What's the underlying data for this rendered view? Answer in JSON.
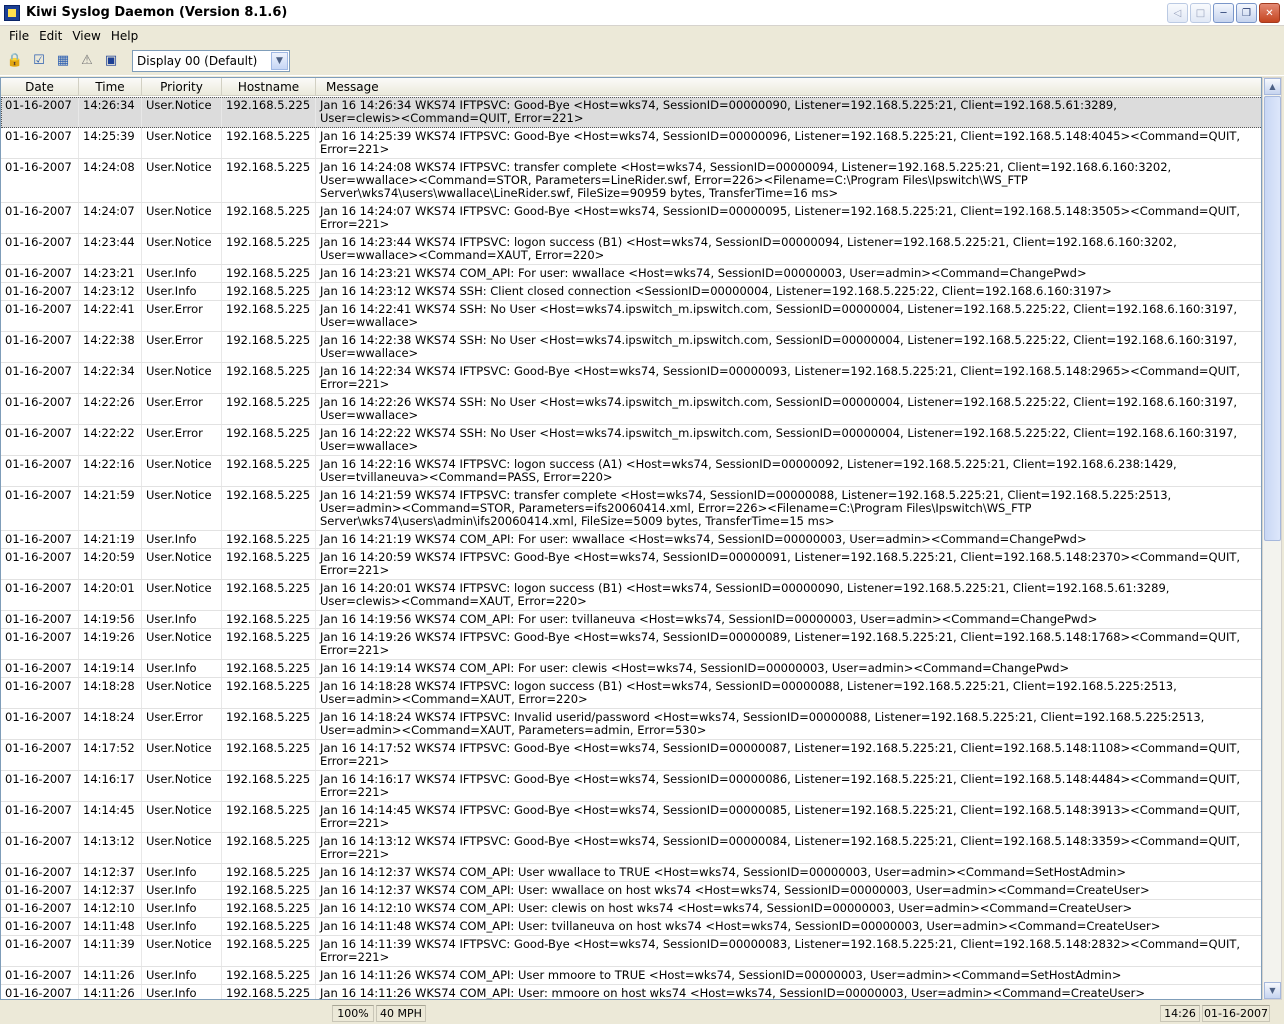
{
  "window": {
    "title": "Kiwi Syslog Daemon (Version 8.1.6)"
  },
  "menu": [
    "File",
    "Edit",
    "View",
    "Help"
  ],
  "toolbar": {
    "icons": [
      "lock-icon",
      "checklist-icon",
      "chart-icon",
      "warning-icon",
      "monitor-icon"
    ],
    "display_select": "Display 00 (Default)"
  },
  "columns": [
    "Date",
    "Time",
    "Priority",
    "Hostname",
    "Message"
  ],
  "rows": [
    {
      "date": "01-16-2007",
      "time": "14:26:34",
      "priority": "User.Notice",
      "host": "192.168.5.225",
      "message": "Jan 16 14:26:34 WKS74 IFTPSVC: Good-Bye <Host=wks74, SessionID=00000090, Listener=192.168.5.225:21, Client=192.168.5.61:3289,\nUser=clewis><Command=QUIT, Error=221>"
    },
    {
      "date": "01-16-2007",
      "time": "14:25:39",
      "priority": "User.Notice",
      "host": "192.168.5.225",
      "message": "Jan 16 14:25:39 WKS74 IFTPSVC: Good-Bye <Host=wks74, SessionID=00000096, Listener=192.168.5.225:21, Client=192.168.5.148:4045><Command=QUIT,\nError=221>"
    },
    {
      "date": "01-16-2007",
      "time": "14:24:08",
      "priority": "User.Notice",
      "host": "192.168.5.225",
      "message": "Jan 16 14:24:08 WKS74 IFTPSVC: transfer complete <Host=wks74, SessionID=00000094, Listener=192.168.5.225:21, Client=192.168.6.160:3202,\nUser=wwallace><Command=STOR, Parameters=LineRider.swf, Error=226><Filename=C:\\Program Files\\Ipswitch\\WS_FTP\nServer\\wks74\\users\\wwallace\\LineRider.swf, FileSize=90959 bytes, TransferTime=16 ms>"
    },
    {
      "date": "01-16-2007",
      "time": "14:24:07",
      "priority": "User.Notice",
      "host": "192.168.5.225",
      "message": "Jan 16 14:24:07 WKS74 IFTPSVC: Good-Bye <Host=wks74, SessionID=00000095, Listener=192.168.5.225:21, Client=192.168.5.148:3505><Command=QUIT,\nError=221>"
    },
    {
      "date": "01-16-2007",
      "time": "14:23:44",
      "priority": "User.Notice",
      "host": "192.168.5.225",
      "message": "Jan 16 14:23:44 WKS74 IFTPSVC: logon success (B1) <Host=wks74, SessionID=00000094, Listener=192.168.5.225:21, Client=192.168.6.160:3202,\nUser=wwallace><Command=XAUT, Error=220>"
    },
    {
      "date": "01-16-2007",
      "time": "14:23:21",
      "priority": "User.Info",
      "host": "192.168.5.225",
      "message": "Jan 16 14:23:21 WKS74 COM_API: For user: wwallace <Host=wks74, SessionID=00000003, User=admin><Command=ChangePwd>"
    },
    {
      "date": "01-16-2007",
      "time": "14:23:12",
      "priority": "User.Info",
      "host": "192.168.5.225",
      "message": "Jan 16 14:23:12 WKS74 SSH: Client closed connection <SessionID=00000004, Listener=192.168.5.225:22, Client=192.168.6.160:3197>"
    },
    {
      "date": "01-16-2007",
      "time": "14:22:41",
      "priority": "User.Error",
      "host": "192.168.5.225",
      "message": "Jan 16 14:22:41 WKS74 SSH: No User <Host=wks74.ipswitch_m.ipswitch.com, SessionID=00000004, Listener=192.168.5.225:22, Client=192.168.6.160:3197,\nUser=wwallace>"
    },
    {
      "date": "01-16-2007",
      "time": "14:22:38",
      "priority": "User.Error",
      "host": "192.168.5.225",
      "message": "Jan 16 14:22:38 WKS74 SSH: No User <Host=wks74.ipswitch_m.ipswitch.com, SessionID=00000004, Listener=192.168.5.225:22, Client=192.168.6.160:3197,\nUser=wwallace>"
    },
    {
      "date": "01-16-2007",
      "time": "14:22:34",
      "priority": "User.Notice",
      "host": "192.168.5.225",
      "message": "Jan 16 14:22:34 WKS74 IFTPSVC: Good-Bye <Host=wks74, SessionID=00000093, Listener=192.168.5.225:21, Client=192.168.5.148:2965><Command=QUIT,\nError=221>"
    },
    {
      "date": "01-16-2007",
      "time": "14:22:26",
      "priority": "User.Error",
      "host": "192.168.5.225",
      "message": "Jan 16 14:22:26 WKS74 SSH: No User <Host=wks74.ipswitch_m.ipswitch.com, SessionID=00000004, Listener=192.168.5.225:22, Client=192.168.6.160:3197,\nUser=wwallace>"
    },
    {
      "date": "01-16-2007",
      "time": "14:22:22",
      "priority": "User.Error",
      "host": "192.168.5.225",
      "message": "Jan 16 14:22:22 WKS74 SSH: No User <Host=wks74.ipswitch_m.ipswitch.com, SessionID=00000004, Listener=192.168.5.225:22, Client=192.168.6.160:3197,\nUser=wwallace>"
    },
    {
      "date": "01-16-2007",
      "time": "14:22:16",
      "priority": "User.Notice",
      "host": "192.168.5.225",
      "message": "Jan 16 14:22:16 WKS74 IFTPSVC: logon success (A1) <Host=wks74, SessionID=00000092, Listener=192.168.5.225:21, Client=192.168.6.238:1429,\nUser=tvillaneuva><Command=PASS, Error=220>"
    },
    {
      "date": "01-16-2007",
      "time": "14:21:59",
      "priority": "User.Notice",
      "host": "192.168.5.225",
      "message": "Jan 16 14:21:59 WKS74 IFTPSVC: transfer complete <Host=wks74, SessionID=00000088, Listener=192.168.5.225:21, Client=192.168.5.225:2513,\nUser=admin><Command=STOR, Parameters=ifs20060414.xml, Error=226><Filename=C:\\Program Files\\Ipswitch\\WS_FTP\nServer\\wks74\\users\\admin\\ifs20060414.xml, FileSize=5009 bytes, TransferTime=15 ms>"
    },
    {
      "date": "01-16-2007",
      "time": "14:21:19",
      "priority": "User.Info",
      "host": "192.168.5.225",
      "message": "Jan 16 14:21:19 WKS74 COM_API: For user: wwallace <Host=wks74, SessionID=00000003, User=admin><Command=ChangePwd>"
    },
    {
      "date": "01-16-2007",
      "time": "14:20:59",
      "priority": "User.Notice",
      "host": "192.168.5.225",
      "message": "Jan 16 14:20:59 WKS74 IFTPSVC: Good-Bye <Host=wks74, SessionID=00000091, Listener=192.168.5.225:21, Client=192.168.5.148:2370><Command=QUIT,\nError=221>"
    },
    {
      "date": "01-16-2007",
      "time": "14:20:01",
      "priority": "User.Notice",
      "host": "192.168.5.225",
      "message": "Jan 16 14:20:01 WKS74 IFTPSVC: logon success (B1) <Host=wks74, SessionID=00000090, Listener=192.168.5.225:21, Client=192.168.5.61:3289,\nUser=clewis><Command=XAUT, Error=220>"
    },
    {
      "date": "01-16-2007",
      "time": "14:19:56",
      "priority": "User.Info",
      "host": "192.168.5.225",
      "message": "Jan 16 14:19:56 WKS74 COM_API: For user: tvillaneuva <Host=wks74, SessionID=00000003, User=admin><Command=ChangePwd>"
    },
    {
      "date": "01-16-2007",
      "time": "14:19:26",
      "priority": "User.Notice",
      "host": "192.168.5.225",
      "message": "Jan 16 14:19:26 WKS74 IFTPSVC: Good-Bye <Host=wks74, SessionID=00000089, Listener=192.168.5.225:21, Client=192.168.5.148:1768><Command=QUIT,\nError=221>"
    },
    {
      "date": "01-16-2007",
      "time": "14:19:14",
      "priority": "User.Info",
      "host": "192.168.5.225",
      "message": "Jan 16 14:19:14 WKS74 COM_API: For user: clewis <Host=wks74, SessionID=00000003, User=admin><Command=ChangePwd>"
    },
    {
      "date": "01-16-2007",
      "time": "14:18:28",
      "priority": "User.Notice",
      "host": "192.168.5.225",
      "message": "Jan 16 14:18:28 WKS74 IFTPSVC: logon success (B1) <Host=wks74, SessionID=00000088, Listener=192.168.5.225:21, Client=192.168.5.225:2513,\nUser=admin><Command=XAUT, Error=220>"
    },
    {
      "date": "01-16-2007",
      "time": "14:18:24",
      "priority": "User.Error",
      "host": "192.168.5.225",
      "message": "Jan 16 14:18:24 WKS74 IFTPSVC: Invalid userid/password <Host=wks74, SessionID=00000088, Listener=192.168.5.225:21, Client=192.168.5.225:2513,\nUser=admin><Command=XAUT, Parameters=admin, Error=530>"
    },
    {
      "date": "01-16-2007",
      "time": "14:17:52",
      "priority": "User.Notice",
      "host": "192.168.5.225",
      "message": "Jan 16 14:17:52 WKS74 IFTPSVC: Good-Bye <Host=wks74, SessionID=00000087, Listener=192.168.5.225:21, Client=192.168.5.148:1108><Command=QUIT,\nError=221>"
    },
    {
      "date": "01-16-2007",
      "time": "14:16:17",
      "priority": "User.Notice",
      "host": "192.168.5.225",
      "message": "Jan 16 14:16:17 WKS74 IFTPSVC: Good-Bye <Host=wks74, SessionID=00000086, Listener=192.168.5.225:21, Client=192.168.5.148:4484><Command=QUIT,\nError=221>"
    },
    {
      "date": "01-16-2007",
      "time": "14:14:45",
      "priority": "User.Notice",
      "host": "192.168.5.225",
      "message": "Jan 16 14:14:45 WKS74 IFTPSVC: Good-Bye <Host=wks74, SessionID=00000085, Listener=192.168.5.225:21, Client=192.168.5.148:3913><Command=QUIT,\nError=221>"
    },
    {
      "date": "01-16-2007",
      "time": "14:13:12",
      "priority": "User.Notice",
      "host": "192.168.5.225",
      "message": "Jan 16 14:13:12 WKS74 IFTPSVC: Good-Bye <Host=wks74, SessionID=00000084, Listener=192.168.5.225:21, Client=192.168.5.148:3359><Command=QUIT,\nError=221>"
    },
    {
      "date": "01-16-2007",
      "time": "14:12:37",
      "priority": "User.Info",
      "host": "192.168.5.225",
      "message": "Jan 16 14:12:37 WKS74 COM_API: User wwallace to TRUE <Host=wks74, SessionID=00000003, User=admin><Command=SetHostAdmin>"
    },
    {
      "date": "01-16-2007",
      "time": "14:12:37",
      "priority": "User.Info",
      "host": "192.168.5.225",
      "message": "Jan 16 14:12:37 WKS74 COM_API: User: wwallace on host wks74 <Host=wks74, SessionID=00000003, User=admin><Command=CreateUser>"
    },
    {
      "date": "01-16-2007",
      "time": "14:12:10",
      "priority": "User.Info",
      "host": "192.168.5.225",
      "message": "Jan 16 14:12:10 WKS74 COM_API: User: clewis on host wks74 <Host=wks74, SessionID=00000003, User=admin><Command=CreateUser>"
    },
    {
      "date": "01-16-2007",
      "time": "14:11:48",
      "priority": "User.Info",
      "host": "192.168.5.225",
      "message": "Jan 16 14:11:48 WKS74 COM_API: User: tvillaneuva on host wks74 <Host=wks74, SessionID=00000003, User=admin><Command=CreateUser>"
    },
    {
      "date": "01-16-2007",
      "time": "14:11:39",
      "priority": "User.Notice",
      "host": "192.168.5.225",
      "message": "Jan 16 14:11:39 WKS74 IFTPSVC: Good-Bye <Host=wks74, SessionID=00000083, Listener=192.168.5.225:21, Client=192.168.5.148:2832><Command=QUIT,\nError=221>"
    },
    {
      "date": "01-16-2007",
      "time": "14:11:26",
      "priority": "User.Info",
      "host": "192.168.5.225",
      "message": "Jan 16 14:11:26 WKS74 COM_API: User mmoore to TRUE <Host=wks74, SessionID=00000003, User=admin><Command=SetHostAdmin>"
    },
    {
      "date": "01-16-2007",
      "time": "14:11:26",
      "priority": "User.Info",
      "host": "192.168.5.225",
      "message": "Jan 16 14:11:26 WKS74 COM_API: User: mmoore on host wks74 <Host=wks74, SessionID=00000003, User=admin><Command=CreateUser>"
    }
  ],
  "status": {
    "zoom": "100%",
    "speed": "40 MPH",
    "time": "14:26",
    "date": "01-16-2007"
  }
}
